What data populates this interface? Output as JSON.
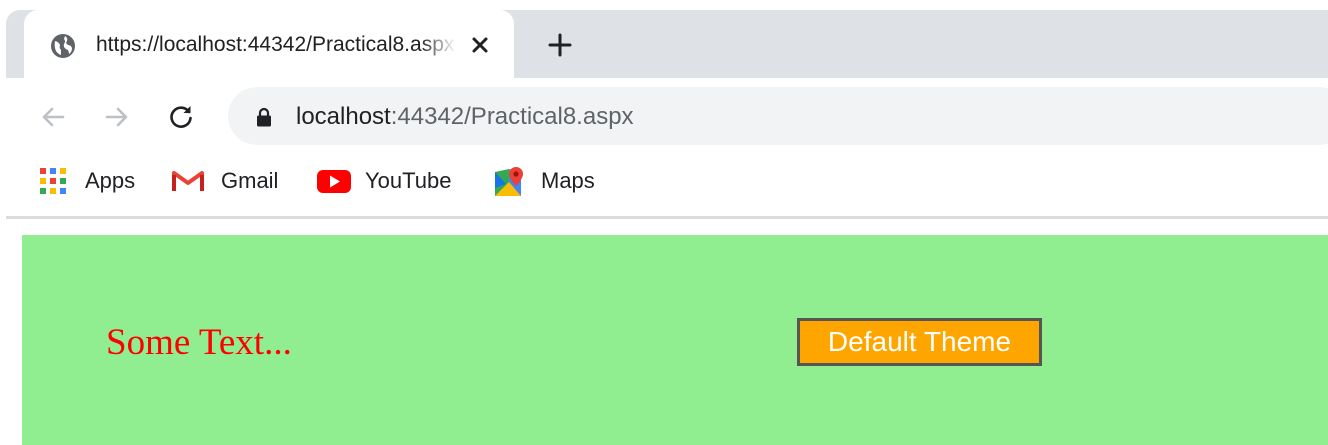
{
  "browser": {
    "tab": {
      "title": "https://localhost:44342/Practical8.aspx"
    },
    "address": {
      "host": "localhost",
      "path": ":44342/Practical8.aspx"
    },
    "bookmarks": [
      {
        "label": "Apps",
        "icon": "apps-grid-icon"
      },
      {
        "label": "Gmail",
        "icon": "gmail-icon"
      },
      {
        "label": "YouTube",
        "icon": "youtube-icon"
      },
      {
        "label": "Maps",
        "icon": "maps-icon"
      }
    ]
  },
  "page": {
    "text": "Some Text...",
    "button_label": "Default Theme",
    "colors": {
      "background": "#90ee90",
      "text": "#ff0000",
      "button_bg": "#ffa500",
      "button_text": "#ffffff"
    }
  }
}
